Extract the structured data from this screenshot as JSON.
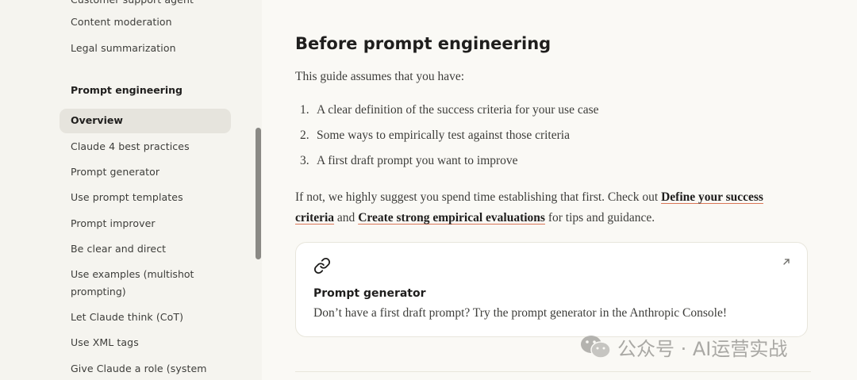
{
  "sidebar": {
    "clipped_top_item": "Customer support agent",
    "items_top": [
      "Content moderation",
      "Legal summarization"
    ],
    "section_title": "Prompt engineering",
    "active_item": "Overview",
    "items": [
      "Claude 4 best practices",
      "Prompt generator",
      "Use prompt templates",
      "Prompt improver",
      "Be clear and direct",
      "Use examples (multishot prompting)",
      "Let Claude think (CoT)",
      "Use XML tags",
      "Give Claude a role (system"
    ]
  },
  "main": {
    "heading": "Before prompt engineering",
    "intro": "This guide assumes that you have:",
    "list": [
      {
        "num": "1.",
        "text": "A clear definition of the success criteria for your use case"
      },
      {
        "num": "2.",
        "text": "Some ways to empirically test against those criteria"
      },
      {
        "num": "3.",
        "text": "A first draft prompt you want to improve"
      }
    ],
    "notice_prefix": "If not, we highly suggest you spend time establishing that first. Check out ",
    "link1": "Define your success criteria",
    "notice_mid": " and ",
    "link2": "Create strong empirical evaluations",
    "notice_suffix": " for tips and guidance.",
    "card": {
      "title": "Prompt generator",
      "description": "Don’t have a first draft prompt? Try the prompt generator in the Anthropic Console!",
      "icon": "link-icon",
      "external_icon": "external-arrow-icon"
    }
  },
  "watermark": {
    "text": "公众号 · AI运营实战",
    "icon": "wechat-icon"
  }
}
